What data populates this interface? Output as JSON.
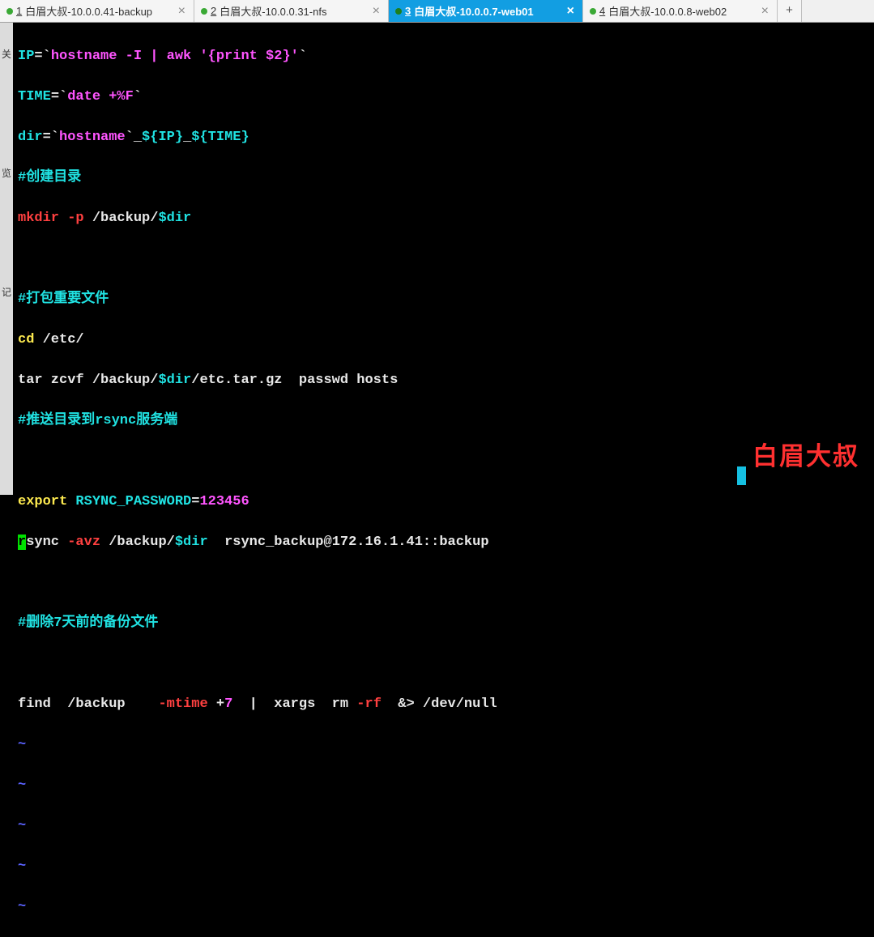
{
  "tabs": [
    {
      "num": "1",
      "label": "白眉大叔-10.0.0.41-backup"
    },
    {
      "num": "2",
      "label": "白眉大叔-10.0.0.31-nfs"
    },
    {
      "num": "3",
      "label": "白眉大叔-10.0.0.7-web01"
    },
    {
      "num": "4",
      "label": "白眉大叔-10.0.0.8-web02"
    }
  ],
  "active_tab_index": 2,
  "sidebar": [
    "关",
    "览",
    "记"
  ],
  "watermark": "白眉大叔",
  "code": {
    "l1_var": "IP",
    "l1_eq": "=`",
    "l1_cmd": "hostname -I | awk '{print $2}'",
    "l1_end": "`",
    "l2_var": "TIME",
    "l2_eq": "=`",
    "l2_cmd": "date +%F",
    "l2_end": "`",
    "l3_var": "dir",
    "l3_eq": "=`",
    "l3_cmd": "hostname",
    "l3_end": "`",
    "l3_a": "_",
    "l3_b": "${IP}",
    "l3_c": "_",
    "l3_d": "${TIME}",
    "c1": "#创建目录",
    "l4a": "mkdir -p ",
    "l4b": "/backup/",
    "l4c": "$dir",
    "c2": "#打包重要文件",
    "l5a": "cd ",
    "l5b": "/etc/",
    "l6a": "tar zcvf /backup/",
    "l6b": "$dir",
    "l6c": "/etc.tar.gz  passwd hosts",
    "c3": "#推送目录到rsync服务端",
    "l7a": "export ",
    "l7b": "RSYNC_PASSWORD",
    "l7c": "=",
    "l7d": "123456",
    "l8cur": "r",
    "l8a": "sync ",
    "l8b": "-avz",
    "l8c": " /backup/",
    "l8d": "$dir",
    "l8e": "  rsync_backup@172.16.1.41::backup",
    "c4": "#删除7天前的备份文件",
    "l9a": "find  /backup    ",
    "l9b": "-mtime",
    "l9c": " +",
    "l9d": "7",
    "l9e": "  |  xargs  rm ",
    "l9f": "-rf",
    "l9g": "  &> /dev/null",
    "tilde": "~"
  }
}
